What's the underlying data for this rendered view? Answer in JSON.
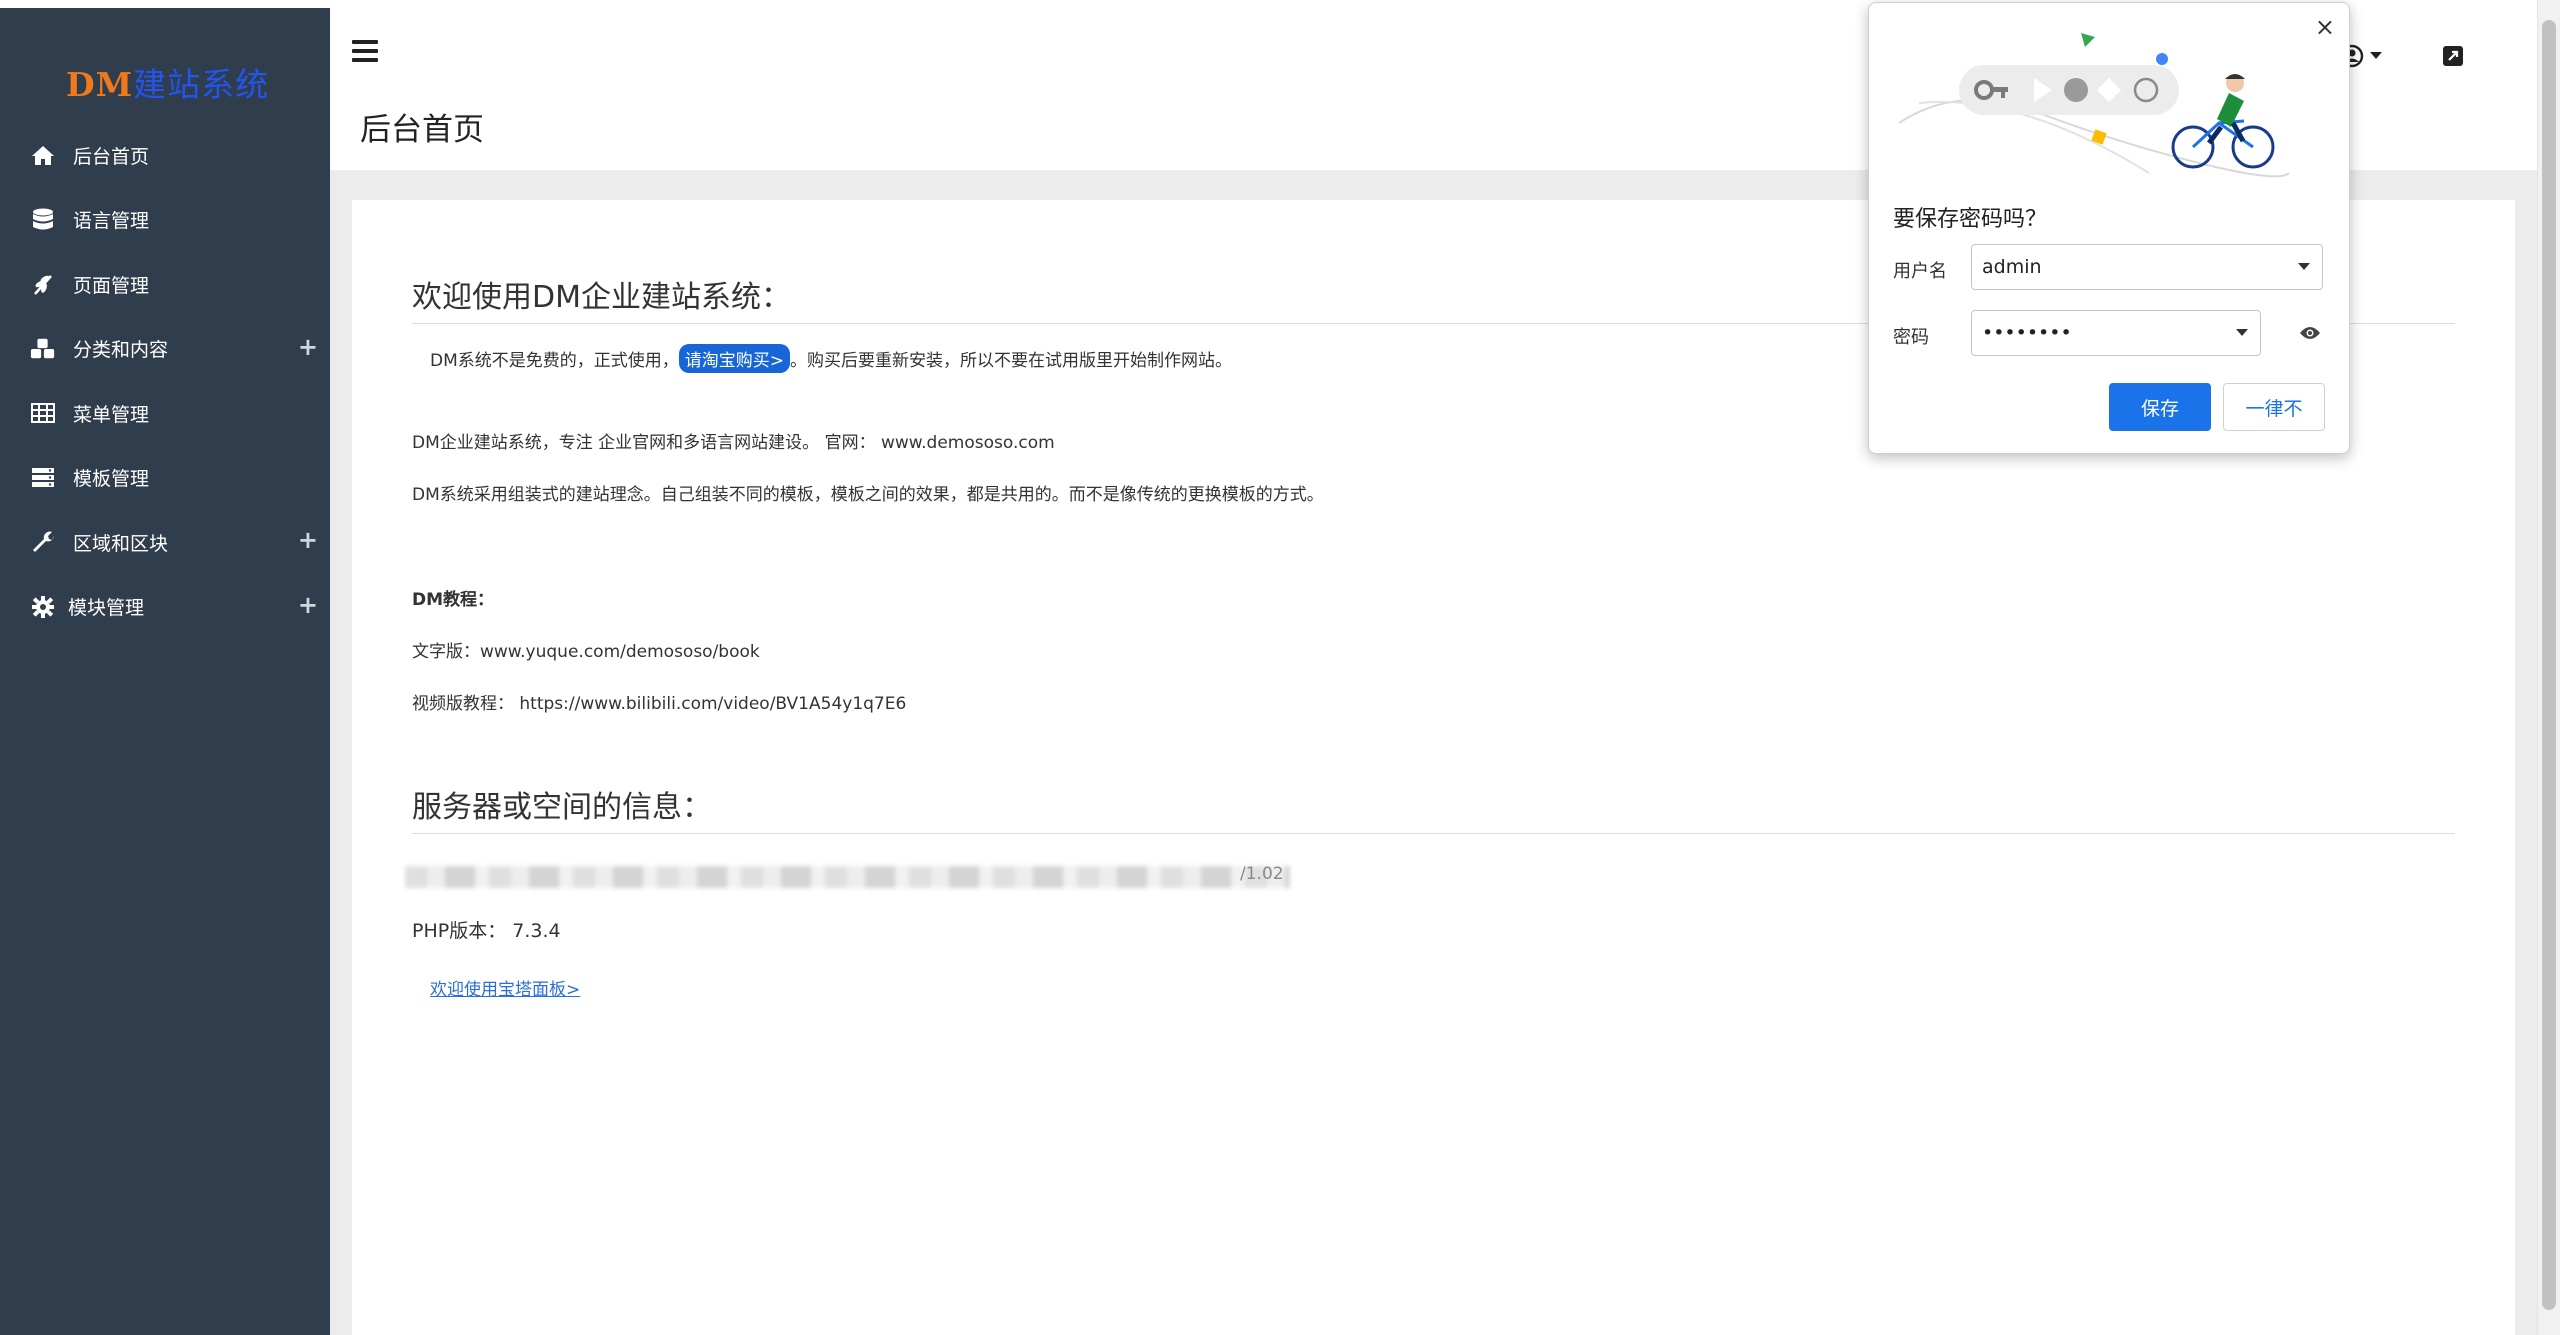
{
  "sidebar": {
    "logo_dm": "DM",
    "logo_rest": "建站系统",
    "items": [
      {
        "label": "后台首页",
        "icon": "home-icon",
        "expandable": false
      },
      {
        "label": "语言管理",
        "icon": "database-icon",
        "expandable": false
      },
      {
        "label": "页面管理",
        "icon": "wheat-icon",
        "expandable": false
      },
      {
        "label": "分类和内容",
        "icon": "cubes-icon",
        "expandable": true
      },
      {
        "label": "菜单管理",
        "icon": "table-icon",
        "expandable": false
      },
      {
        "label": "模板管理",
        "icon": "server-icon",
        "expandable": false
      },
      {
        "label": "区域和区块",
        "icon": "wrench-icon",
        "expandable": true
      },
      {
        "label": "模块管理",
        "icon": "gear-icon",
        "expandable": true
      }
    ],
    "plus_symbol": "+"
  },
  "header": {
    "page_title": "后台首页"
  },
  "main": {
    "welcome_title": "欢迎使用DM企业建站系统：",
    "notice_before": "DM系统不是免费的，正式使用，",
    "buy_button": "请淘宝购买>",
    "notice_after": "。购买后要重新安装，所以不要在试用版里开始制作网站。",
    "intro_line1": "DM企业建站系统，专注 企业官网和多语言网站建设。 官网： www.demososo.com",
    "intro_line2": "DM系统采用组装式的建站理念。自己组装不同的模板，模板之间的效果，都是共用的。而不是像传统的更换模板的方式。",
    "tutorial_heading": "DM教程：",
    "tutorial_text": "文字版：www.yuque.com/demososo/book",
    "tutorial_video": "视频版教程： https://www.bilibili.com/video/BV1A54y1q7E6",
    "server_title": "服务器或空间的信息：",
    "server_blurred_tail": "/1.02",
    "php_version": "PHP版本： 7.3.4",
    "panel_link": "欢迎使用宝塔面板>"
  },
  "password_dialog": {
    "title": "要保存密码吗？",
    "username_label": "用户名",
    "username_value": "admin",
    "password_label": "密码",
    "password_value": "••••••••",
    "save_button": "保存",
    "never_button": "一律不",
    "close_symbol": "×"
  },
  "colors": {
    "sidebar_bg": "#2f3d4c",
    "logo_dm": "#ee7a1c",
    "logo_rest": "#2255ee",
    "accent_blue": "#1a73e8",
    "buy_button_bg": "#1865d8"
  }
}
